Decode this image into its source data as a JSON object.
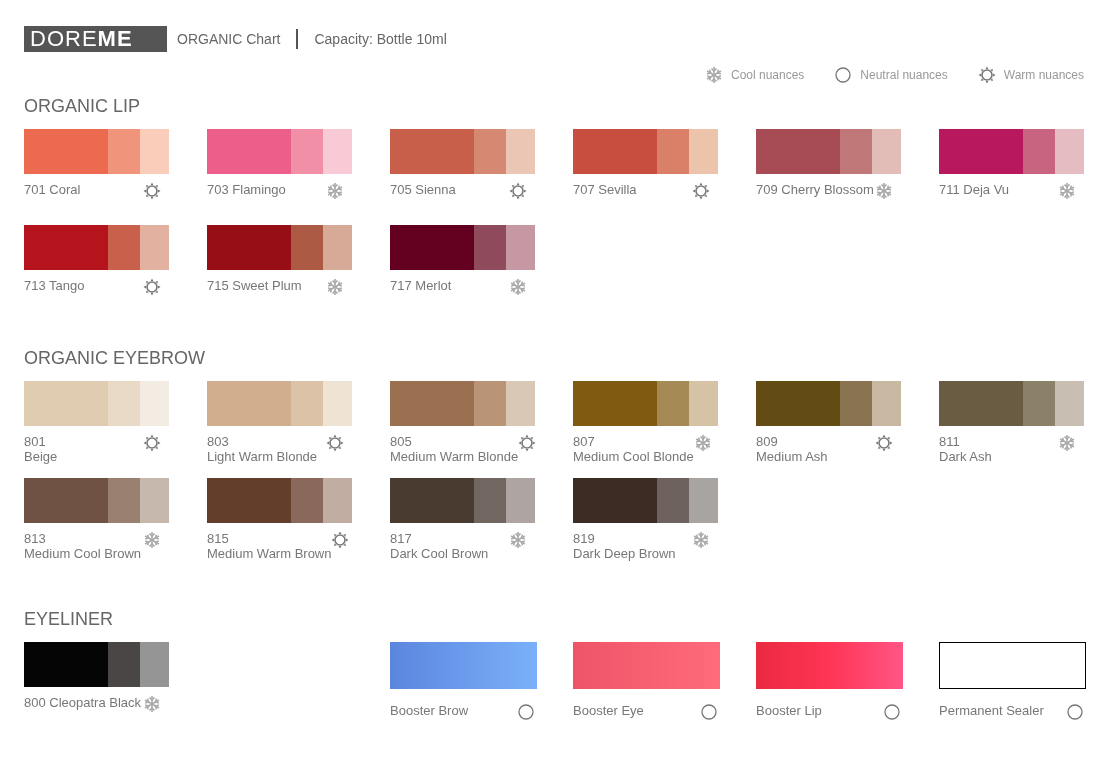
{
  "header": {
    "logo": "DORE**ME**",
    "title": "ORGANIC Chart",
    "capacity": "Capacity: Bottle 10ml"
  },
  "legend": [
    {
      "kind": "cool",
      "label": "Cool nuances"
    },
    {
      "kind": "neutral",
      "label": "Neutral nuances"
    },
    {
      "kind": "warm",
      "label": "Warm nuances"
    }
  ],
  "sections": [
    {
      "title": "ORGANIC LIP",
      "items": [
        {
          "label": "701 Coral",
          "kind": "warm",
          "swatches": [
            {
              "color": "#ec6a50"
            },
            {
              "color": "#f0957b"
            },
            {
              "color": "#f9cdb9"
            }
          ]
        },
        {
          "label": "703 Flamingo",
          "kind": "cool",
          "swatches": [
            {
              "color": "#ec5f8a"
            },
            {
              "color": "#f08fa6"
            },
            {
              "color": "#f8cad6"
            }
          ]
        },
        {
          "label": "705 Sienna",
          "kind": "warm",
          "swatches": [
            {
              "color": "#c85f4b"
            },
            {
              "color": "#d58872"
            },
            {
              "color": "#ecc6b4"
            }
          ]
        },
        {
          "label": "707 Sevilla",
          "kind": "warm",
          "swatches": [
            {
              "color": "#c84f3f"
            },
            {
              "color": "#db8068"
            },
            {
              "color": "#ecc3ab"
            }
          ]
        },
        {
          "label": "709 Cherry Blossom",
          "kind": "cool",
          "swatches": [
            {
              "color": "#a74b55"
            },
            {
              "color": "#c07777"
            },
            {
              "color": "#e2bcb7"
            }
          ]
        },
        {
          "label": "711 Deja Vu",
          "kind": "cool",
          "swatches": [
            {
              "color": "#b8185e"
            },
            {
              "color": "#c96480"
            },
            {
              "color": "#e6bcc3"
            }
          ]
        },
        {
          "label": "713 Tango",
          "kind": "warm",
          "swatches": [
            {
              "color": "#b5141c"
            },
            {
              "color": "#c8604c"
            },
            {
              "color": "#e3b19f"
            }
          ]
        },
        {
          "label": "715 Sweet Plum",
          "kind": "cool",
          "swatches": [
            {
              "color": "#960f17"
            },
            {
              "color": "#ad5a45"
            },
            {
              "color": "#d7aa98"
            }
          ]
        },
        {
          "label": "717 Merlot",
          "kind": "cool",
          "swatches": [
            {
              "color": "#630020"
            },
            {
              "color": "#8f4a5b"
            },
            {
              "color": "#c598a3"
            }
          ]
        }
      ]
    },
    {
      "title": "ORGANIC EYEBROW",
      "items": [
        {
          "code": "801",
          "name": "Beige",
          "kind": "warm",
          "swatches": [
            {
              "color": "#dfccb1"
            },
            {
              "color": "#e8dac6"
            },
            {
              "color": "#f3ece3"
            }
          ]
        },
        {
          "code": "803",
          "name": "Light Warm Blonde",
          "kind": "warm",
          "swatches": [
            {
              "color": "#d1ae8e"
            },
            {
              "color": "#dcc2a6"
            },
            {
              "color": "#efe3d3"
            }
          ]
        },
        {
          "code": "805",
          "name": "Medium Warm Blonde",
          "kind": "warm",
          "swatches": [
            {
              "color": "#9a7050"
            },
            {
              "color": "#b99477"
            },
            {
              "color": "#dac8b6"
            }
          ]
        },
        {
          "code": "807",
          "name": "Medium Cool Blonde",
          "kind": "cool",
          "swatches": [
            {
              "color": "#7f5a10"
            },
            {
              "color": "#a68a55"
            },
            {
              "color": "#d6c2a5"
            }
          ]
        },
        {
          "code": "809",
          "name": "Medium Ash",
          "kind": "warm",
          "swatches": [
            {
              "color": "#624c13"
            },
            {
              "color": "#8a7350"
            },
            {
              "color": "#c8b8a2"
            }
          ]
        },
        {
          "code": "811",
          "name": "Dark Ash",
          "kind": "cool",
          "swatches": [
            {
              "color": "#695c42"
            },
            {
              "color": "#8a8168"
            },
            {
              "color": "#c8beb2"
            }
          ]
        },
        {
          "code": "813",
          "name": "Medium Cool Brown",
          "kind": "cool",
          "swatches": [
            {
              "color": "#6f5243"
            },
            {
              "color": "#998070"
            },
            {
              "color": "#c7b8ae"
            }
          ]
        },
        {
          "code": "815",
          "name": "Medium Warm Brown",
          "kind": "warm",
          "swatches": [
            {
              "color": "#633f2b"
            },
            {
              "color": "#8a685c"
            },
            {
              "color": "#c2ada2"
            }
          ]
        },
        {
          "code": "817",
          "name": "Dark Cool Brown",
          "kind": "cool",
          "swatches": [
            {
              "color": "#4a3b31"
            },
            {
              "color": "#726760"
            },
            {
              "color": "#aea5a2"
            }
          ]
        },
        {
          "code": "819",
          "name": "Dark Deep Brown",
          "kind": "cool",
          "swatches": [
            {
              "color": "#3d2c24"
            },
            {
              "color": "#6e625e"
            },
            {
              "color": "#a8a4a2"
            }
          ]
        }
      ]
    },
    {
      "title": "EYELINER",
      "items": [
        {
          "label": "800 Cleopatra Black",
          "kind": "cool",
          "swatches": [
            {
              "color": "#050505"
            },
            {
              "color": "#4a4646"
            },
            {
              "color": "#959595"
            }
          ]
        }
      ],
      "extras": [
        {
          "label": "Booster Brow",
          "kind": "neutral",
          "swatch": {
            "kind": "gradient",
            "stops": [
              {
                "color": "#5b86de"
              },
              {
                "color": "#7ab0f9"
              }
            ]
          }
        },
        {
          "label": "Booster Eye",
          "kind": "neutral",
          "swatch": {
            "kind": "gradient",
            "stops": [
              {
                "color": "#ef5468"
              },
              {
                "color": "#ff6b7b"
              }
            ]
          }
        },
        {
          "label": "Booster Lip",
          "kind": "neutral",
          "swatch": {
            "kind": "gradient",
            "stops": [
              {
                "color": "#ea2a40"
              },
              {
                "color": "#ff3555"
              },
              {
                "color": "#ff5585"
              }
            ]
          }
        },
        {
          "label": "Permanent Sealer",
          "kind": "neutral",
          "swatch": {
            "kind": "outline",
            "stops": [
              {
                "color": "#000000"
              }
            ]
          }
        }
      ]
    }
  ]
}
